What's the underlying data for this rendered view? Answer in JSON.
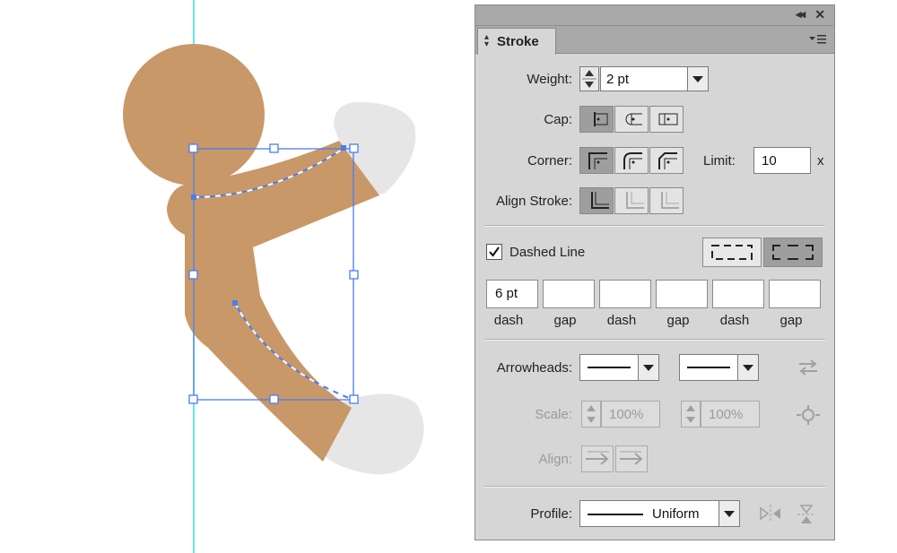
{
  "panel": {
    "tab_label": "Stroke",
    "weight": {
      "label": "Weight:",
      "value": "2 pt"
    },
    "cap": {
      "label": "Cap:",
      "buttons": [
        "butt-cap-icon",
        "round-cap-icon",
        "projecting-cap-icon"
      ],
      "selected": 0
    },
    "corner": {
      "label": "Corner:",
      "buttons": [
        "miter-join-icon",
        "round-join-icon",
        "bevel-join-icon"
      ],
      "selected": 0
    },
    "limit": {
      "label": "Limit:",
      "value": "10",
      "suffix": "x"
    },
    "align_stroke": {
      "label": "Align Stroke:",
      "buttons": [
        "align-center-icon",
        "align-inside-icon",
        "align-outside-icon"
      ],
      "selected": 0
    },
    "dashed_line": {
      "label": "Dashed Line",
      "checked": true
    },
    "dash_fields": [
      {
        "value": "6 pt",
        "label": "dash"
      },
      {
        "value": "",
        "label": "gap"
      },
      {
        "value": "",
        "label": "dash"
      },
      {
        "value": "",
        "label": "gap"
      },
      {
        "value": "",
        "label": "dash"
      },
      {
        "value": "",
        "label": "gap"
      }
    ],
    "arrowheads": {
      "label": "Arrowheads:"
    },
    "scale": {
      "label": "Scale:",
      "start": "100%",
      "end": "100%"
    },
    "align": {
      "label": "Align:"
    },
    "profile": {
      "label": "Profile:",
      "value": "Uniform"
    }
  },
  "colors": {
    "figure": "#c89868",
    "glove": "#e6e6e6",
    "selection": "#4a7df0",
    "guide": "#33e0e0"
  }
}
